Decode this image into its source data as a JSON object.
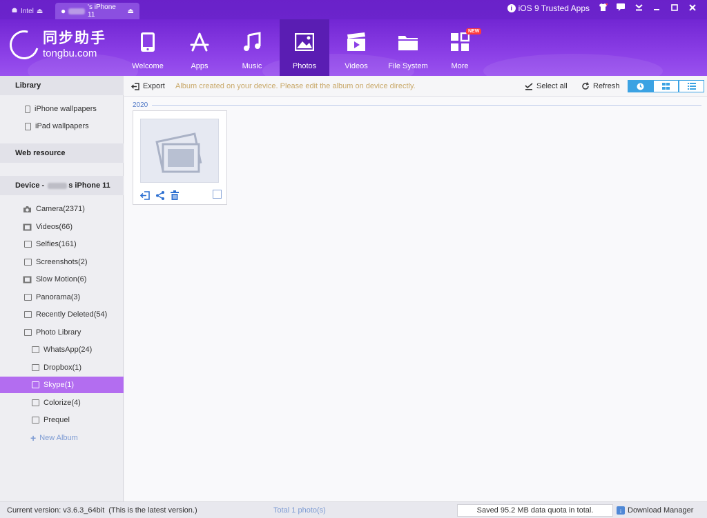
{
  "colors": {
    "nav_dark": "#6a21c9",
    "nav_active": "#5a1db3",
    "selected_item": "#b36df0",
    "accent_blue": "#3ba2e3",
    "hint_text": "#c9a96a"
  },
  "device_tabs": [
    {
      "label": "Intel",
      "icon": "android-icon"
    },
    {
      "label": "'s iPhone 11",
      "icon": "apple-icon"
    }
  ],
  "top_right": {
    "trusted_apps": "iOS 9 Trusted Apps"
  },
  "logo": {
    "cn": "同步助手",
    "en": "tongbu.com"
  },
  "nav": [
    {
      "label": "Welcome",
      "icon": "phone-icon"
    },
    {
      "label": "Apps",
      "icon": "app-store-icon"
    },
    {
      "label": "Music",
      "icon": "music-note-icon"
    },
    {
      "label": "Photos",
      "icon": "image-icon",
      "active": true
    },
    {
      "label": "Videos",
      "icon": "video-clapper-icon"
    },
    {
      "label": "File System",
      "icon": "folder-icon"
    },
    {
      "label": "More",
      "icon": "grid-more-icon",
      "badge": "NEW"
    }
  ],
  "sidebar": {
    "library_title": "Library",
    "library_items": [
      "iPhone wallpapers",
      "iPad wallpapers"
    ],
    "web_title": "Web resource",
    "device_title_prefix": "Device - ",
    "device_title_suffix": "s iPhone 11",
    "device_items": [
      "Camera(2371)",
      "Videos(66)",
      "Selfies(161)",
      "Screenshots(2)",
      "Slow Motion(6)",
      "Panorama(3)",
      "Recently Deleted(54)",
      "Photo Library"
    ],
    "library_children": [
      "WhatsApp(24)",
      "Dropbox(1)",
      "Skype(1)",
      "Colorize(4)",
      "Prequel"
    ],
    "new_album": "New Album"
  },
  "toolbar": {
    "export": "Export",
    "hint": "Album created on your device. Please edit the album on device directly.",
    "select_all": "Select all",
    "refresh": "Refresh"
  },
  "main": {
    "year": "2020"
  },
  "status": {
    "version": "Current version: v3.6.3_64bit",
    "latest": "(This is the latest version.)",
    "total": "Total 1 photo(s)",
    "saved": "Saved 95.2 MB data quota in total.",
    "download_manager": "Download Manager"
  }
}
